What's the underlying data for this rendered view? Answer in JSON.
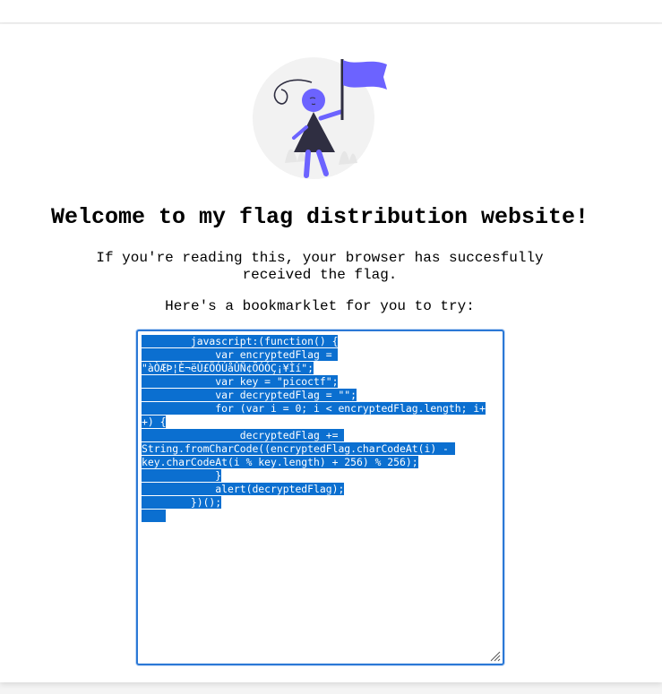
{
  "page": {
    "heading": "Welcome to my flag distribution website!",
    "intro": "If you're reading this, your browser has succesfully received the flag.",
    "try_text": "Here's a bookmarklet for you to try:"
  },
  "bookmarklet": {
    "lines": [
      "        javascript:(function() {",
      "            var encryptedFlag = ",
      "\"àÒÆÞ¦È¬ëÙ£ÖÓÚåÛÑ¢ÕÓÓÇ¡¥Ìí\";",
      "            var key = \"picoctf\";",
      "            var decryptedFlag = \"\";",
      "            for (var i = 0; i < encryptedFlag.length; i+",
      "+) {",
      "                decryptedFlag += ",
      "String.fromCharCode((encryptedFlag.charCodeAt(i) - ",
      "key.charCodeAt(i % key.length) + 256) % 256);",
      "            }",
      "            alert(decryptedFlag);",
      "        })();",
      "    "
    ]
  },
  "icons": {
    "illustration": "person-holding-flag-illustration",
    "resize": "resize-grip-icon"
  },
  "colors": {
    "accent": "#6c63ff",
    "selection": "#0b6fd0",
    "focus_border": "#2b78d6",
    "figure_dark": "#2f2e41"
  }
}
